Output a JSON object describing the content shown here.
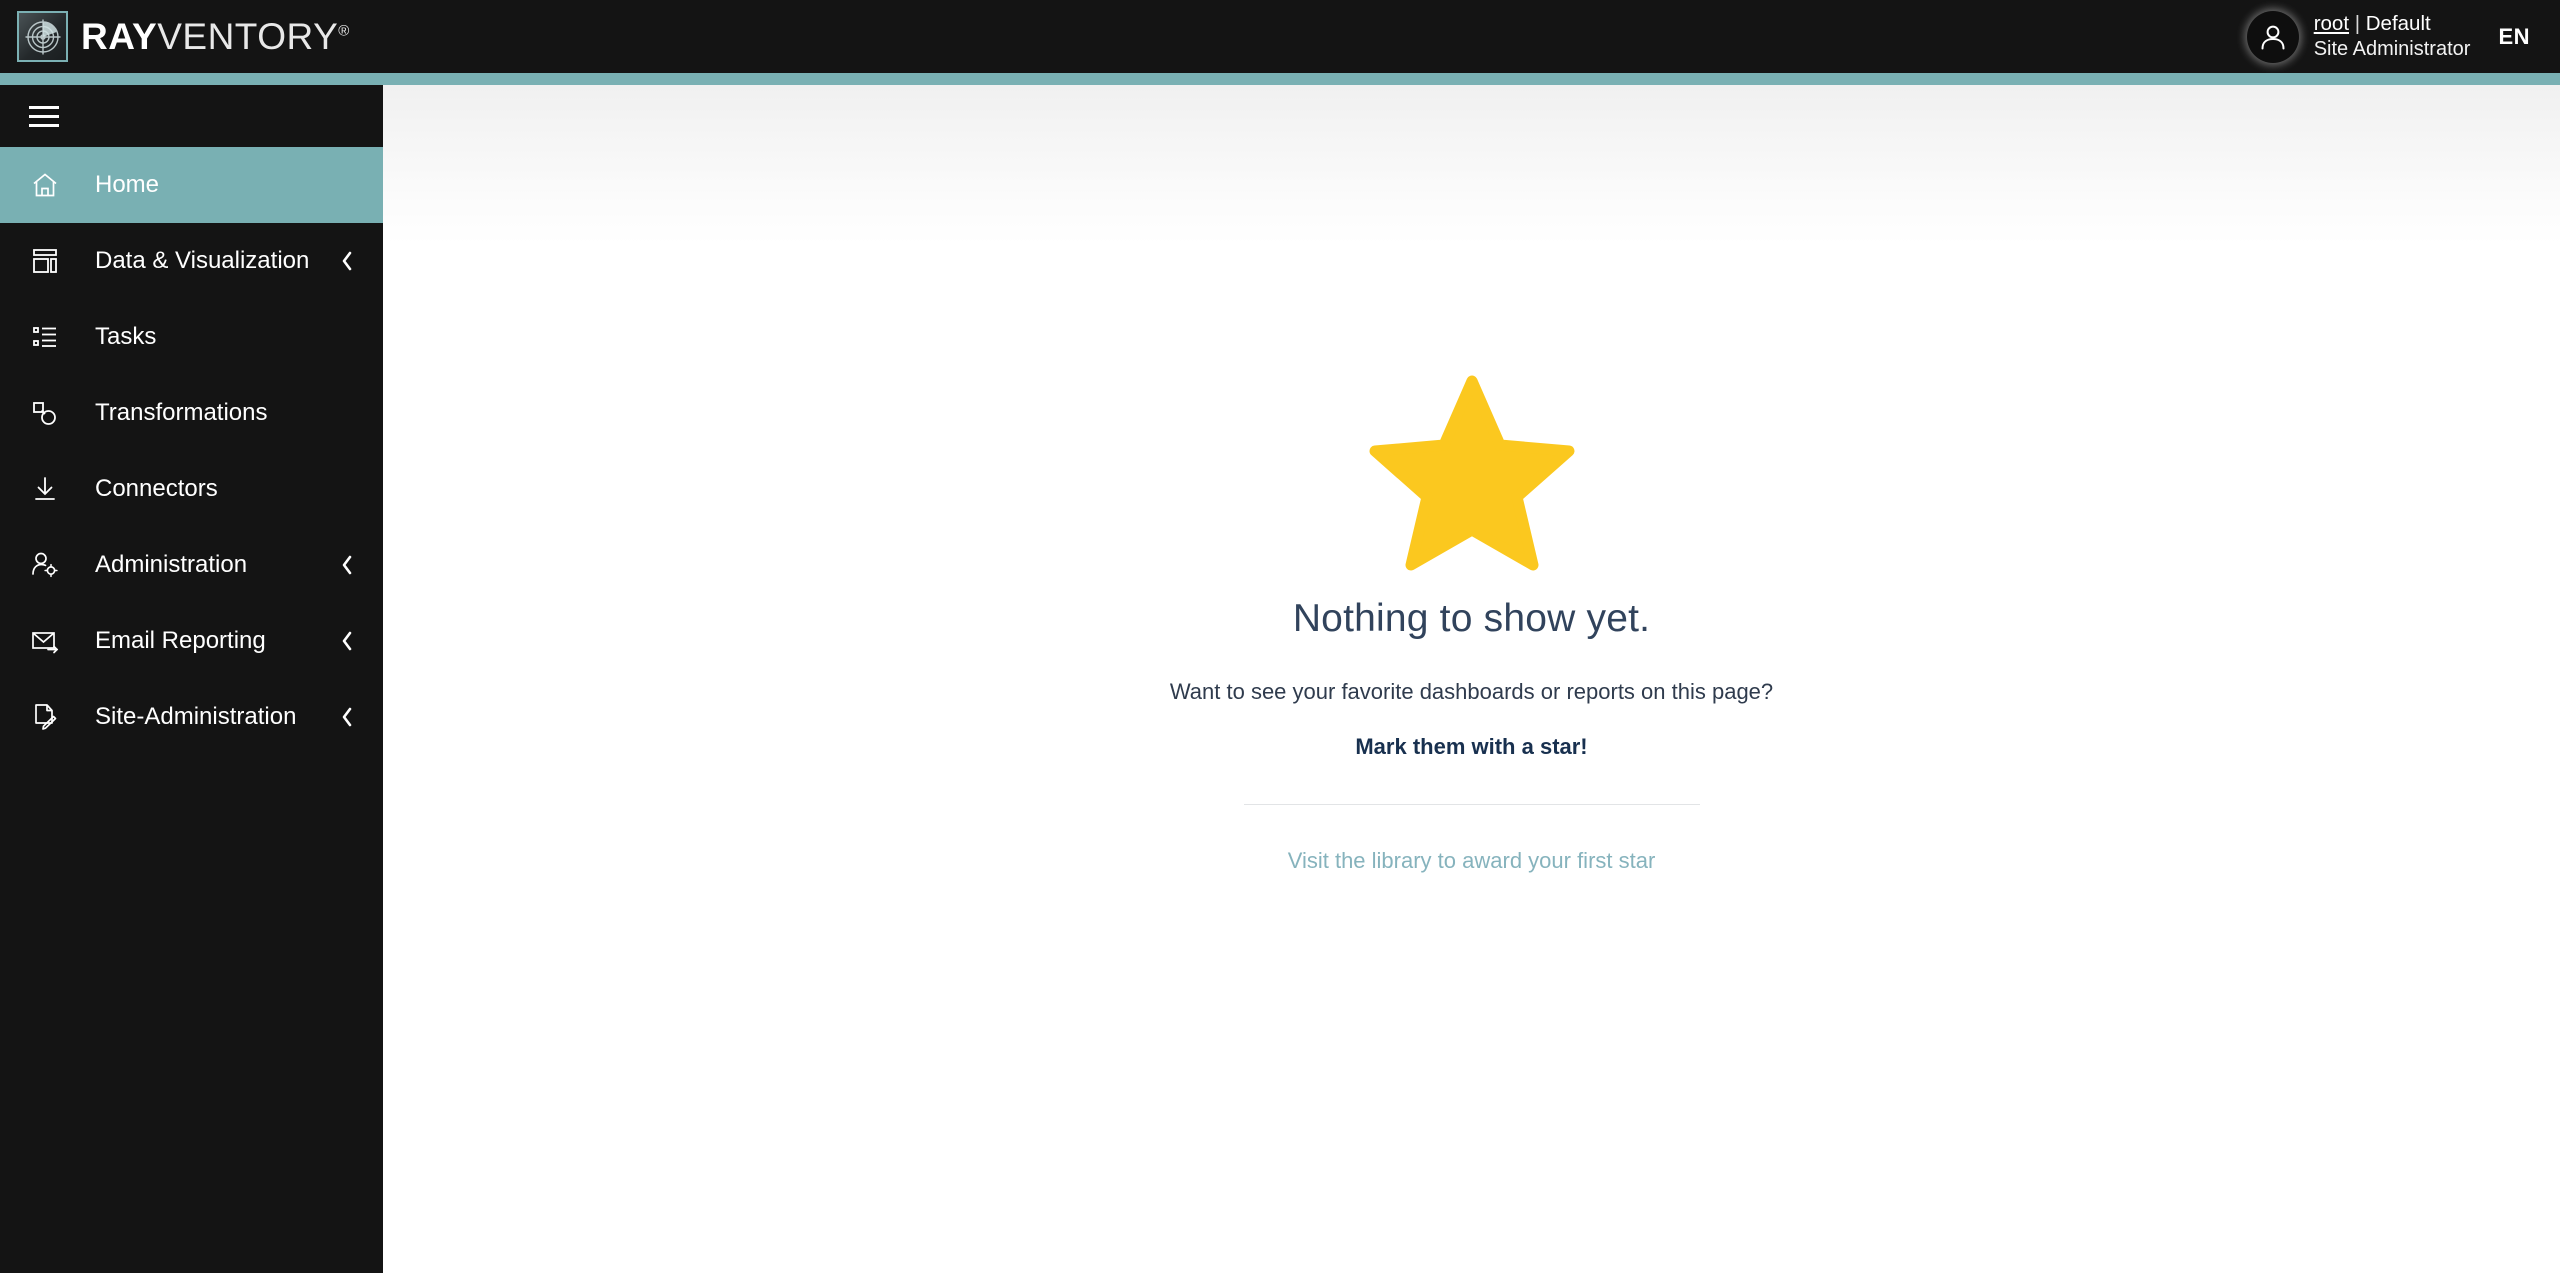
{
  "topbar": {
    "logo_icon": "radar-icon",
    "brand_bold": "RAY",
    "brand_light": "VENTORY",
    "brand_registered": "®",
    "avatar_icon": "user-avatar-icon",
    "user_name": "root",
    "user_separator": " | ",
    "user_tenant": "Default",
    "user_role": "Site Administrator",
    "language": "EN"
  },
  "colors": {
    "accent_teal": "#79b0b3",
    "sidebar_dark": "#141414",
    "star_yellow": "#fbc81f",
    "link_teal": "#86b3bd",
    "heading_navy": "#31435c"
  },
  "sidebar": {
    "menu_toggle_icon": "hamburger-icon",
    "items": [
      {
        "label": "Home",
        "icon": "home-icon",
        "active": true,
        "expandable": false
      },
      {
        "label": "Data & Visualization",
        "icon": "dashboard-icon",
        "active": false,
        "expandable": true
      },
      {
        "label": "Tasks",
        "icon": "list-icon",
        "active": false,
        "expandable": false
      },
      {
        "label": "Transformations",
        "icon": "shapes-icon",
        "active": false,
        "expandable": false
      },
      {
        "label": "Connectors",
        "icon": "download-icon",
        "active": false,
        "expandable": false
      },
      {
        "label": "Administration",
        "icon": "user-gear-icon",
        "active": false,
        "expandable": true
      },
      {
        "label": "Email Reporting",
        "icon": "envelope-arrow-icon",
        "active": false,
        "expandable": true
      },
      {
        "label": "Site-Administration",
        "icon": "document-pen-icon",
        "active": false,
        "expandable": true
      }
    ]
  },
  "main": {
    "illustration_icon": "star-icon",
    "title": "Nothing to show yet.",
    "subtitle": "Want to see your favorite dashboards or reports on this page?",
    "cta": "Mark them with a star!",
    "link": "Visit the library to award your first star"
  }
}
